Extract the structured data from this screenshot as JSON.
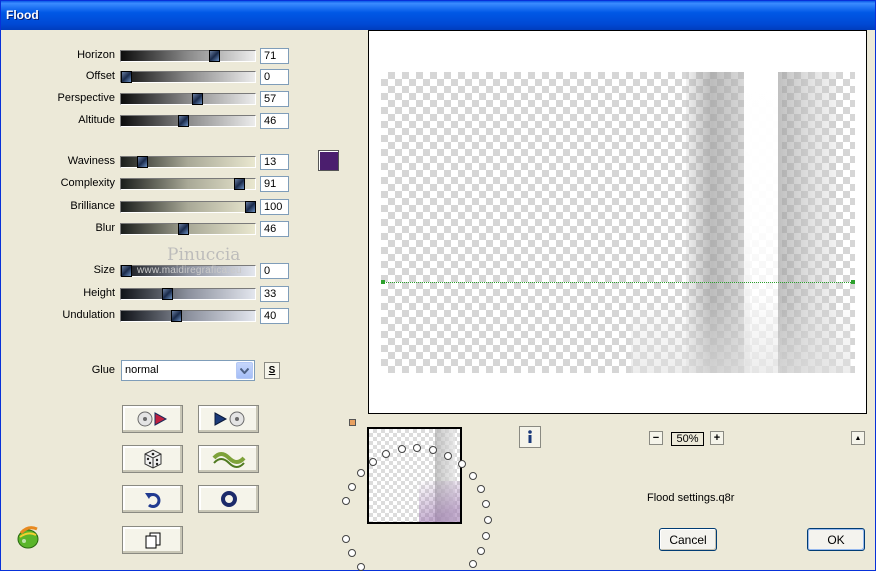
{
  "window": {
    "title": "Flood"
  },
  "params": [
    {
      "key": "horizon",
      "label": "Horizon",
      "value": "71",
      "level": 0.71,
      "grad": "grad-dark"
    },
    {
      "key": "offset",
      "label": "Offset",
      "value": "0",
      "level": 0.0,
      "grad": "grad-dark"
    },
    {
      "key": "perspective",
      "label": "Perspective",
      "value": "57",
      "level": 0.57,
      "grad": "grad-dark"
    },
    {
      "key": "altitude",
      "label": "Altitude",
      "value": "46",
      "level": 0.46,
      "grad": "grad-dark"
    },
    {
      "key": "waviness",
      "label": "Waviness",
      "value": "13",
      "level": 0.13,
      "grad": "grad-beige"
    },
    {
      "key": "complexity",
      "label": "Complexity",
      "value": "91",
      "level": 0.91,
      "grad": "grad-beige"
    },
    {
      "key": "brilliance",
      "label": "Brilliance",
      "value": "100",
      "level": 1.0,
      "grad": "grad-beige"
    },
    {
      "key": "blur",
      "label": "Blur",
      "value": "46",
      "level": 0.46,
      "grad": "grad-beige"
    },
    {
      "key": "size",
      "label": "Size",
      "value": "0",
      "level": 0.0,
      "grad": "grad-blue"
    },
    {
      "key": "height",
      "label": "Height",
      "value": "33",
      "level": 0.33,
      "grad": "grad-blue"
    },
    {
      "key": "undulation",
      "label": "Undulation",
      "value": "40",
      "level": 0.4,
      "grad": "grad-blue"
    }
  ],
  "color_swatch": "#4b1e6e",
  "watermark": {
    "line1": "Pinuccia",
    "line2": "www.maidiregrafica.eu"
  },
  "glue": {
    "label": "Glue",
    "selected": "normal",
    "s_label": "S"
  },
  "zoom": {
    "value": "50%",
    "minus": "−",
    "plus": "+"
  },
  "settings_file": "Flood settings.q8r",
  "buttons": {
    "cancel": "Cancel",
    "ok": "OK",
    "up": "▲"
  }
}
